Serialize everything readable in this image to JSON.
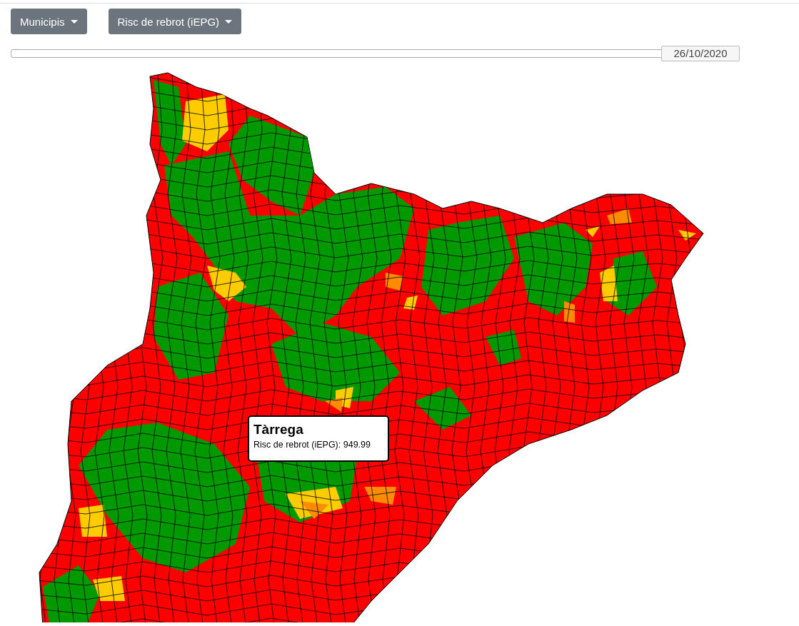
{
  "dropdowns": [
    {
      "label": "Municipis"
    },
    {
      "label": "Risc de rebrot (iEPG)"
    }
  ],
  "timeline": {
    "level": 1,
    "date": "26/10/2020"
  },
  "tooltip": {
    "title": "Tàrrega",
    "text": "Risc de rebrot (iEPG): 949.99"
  }
}
